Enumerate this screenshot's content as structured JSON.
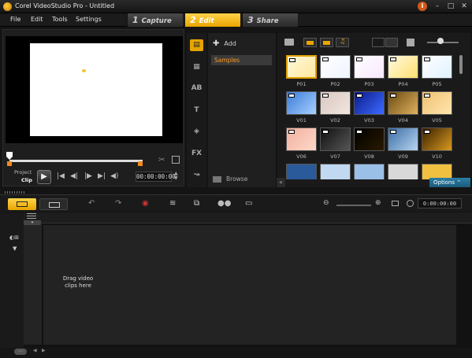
{
  "window": {
    "title": "Corel VideoStudio Pro - Untitled"
  },
  "menu": {
    "items": [
      "File",
      "Edit",
      "Tools",
      "Settings"
    ]
  },
  "steps": [
    {
      "num": "1",
      "label": "Capture"
    },
    {
      "num": "2",
      "label": "Edit",
      "active": true
    },
    {
      "num": "3",
      "label": "Share"
    }
  ],
  "player": {
    "project_label": "Project",
    "clip_label": "Clip",
    "timecode": "00:00:00:00"
  },
  "folders": {
    "add_label": "Add",
    "selected_folder": "Samples",
    "browse_label": "Browse"
  },
  "library": {
    "thumbnails": [
      {
        "label": "P01",
        "selected": true
      },
      {
        "label": "P02"
      },
      {
        "label": "P03"
      },
      {
        "label": "P04"
      },
      {
        "label": "P05"
      },
      {
        "label": "V01"
      },
      {
        "label": "V02"
      },
      {
        "label": "V03"
      },
      {
        "label": "V04"
      },
      {
        "label": "V05"
      },
      {
        "label": "V06"
      },
      {
        "label": "V07"
      },
      {
        "label": "V08"
      },
      {
        "label": "V09"
      },
      {
        "label": "V10"
      }
    ],
    "options_label": "Options"
  },
  "timeline": {
    "timecode": "0:00:00:00",
    "drag_hint": "Drag video clips here"
  },
  "colors": {
    "accent": "#e8a400",
    "options_blue": "#2d7fa8",
    "selected_folder_text": "#ff9a20"
  }
}
